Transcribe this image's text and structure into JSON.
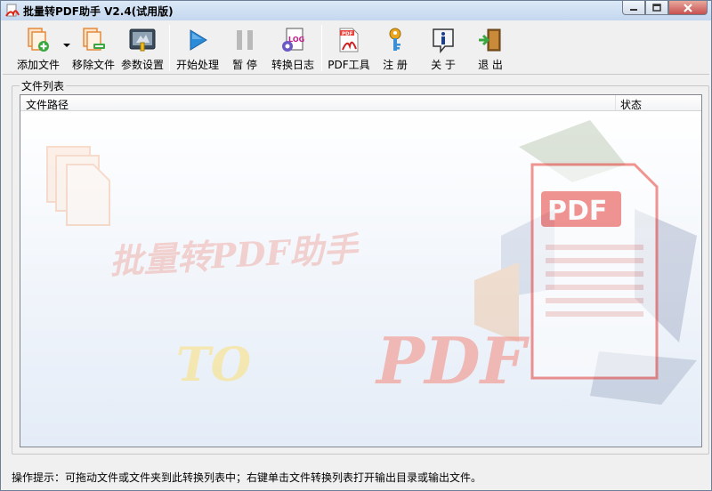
{
  "window": {
    "title": "批量转PDF助手 V2.4(试用版)"
  },
  "toolbar": {
    "buttons": [
      {
        "label": "添加文件",
        "icon": "add-file-icon",
        "has_dropdown": true
      },
      {
        "label": "移除文件",
        "icon": "remove-file-icon"
      },
      {
        "label": "参数设置",
        "icon": "settings-icon"
      },
      {
        "label": "开始处理",
        "icon": "play-icon"
      },
      {
        "label": "暂 停",
        "icon": "pause-icon"
      },
      {
        "label": "转换日志",
        "icon": "log-icon"
      },
      {
        "label": "PDF工具",
        "icon": "pdf-tool-icon"
      },
      {
        "label": "注 册",
        "icon": "register-key-icon"
      },
      {
        "label": "关 于",
        "icon": "info-icon"
      },
      {
        "label": "退 出",
        "icon": "exit-icon"
      }
    ]
  },
  "file_list": {
    "group_label": "文件列表",
    "columns": {
      "path": "文件路径",
      "status": "状态"
    },
    "rows": []
  },
  "watermark": {
    "title": "批量转PDF助手",
    "to_text": "TO",
    "pdf_text": "PDF",
    "badge": "PDF"
  },
  "status": {
    "hint": "操作提示：可拖动文件或文件夹到此转换列表中；右键单击文件转换列表打开输出目录或输出文件。"
  },
  "colors": {
    "accent_blue": "#2a8bd8",
    "pdf_red": "#e8403a",
    "title_gradient_top": "#dbe8f7"
  }
}
